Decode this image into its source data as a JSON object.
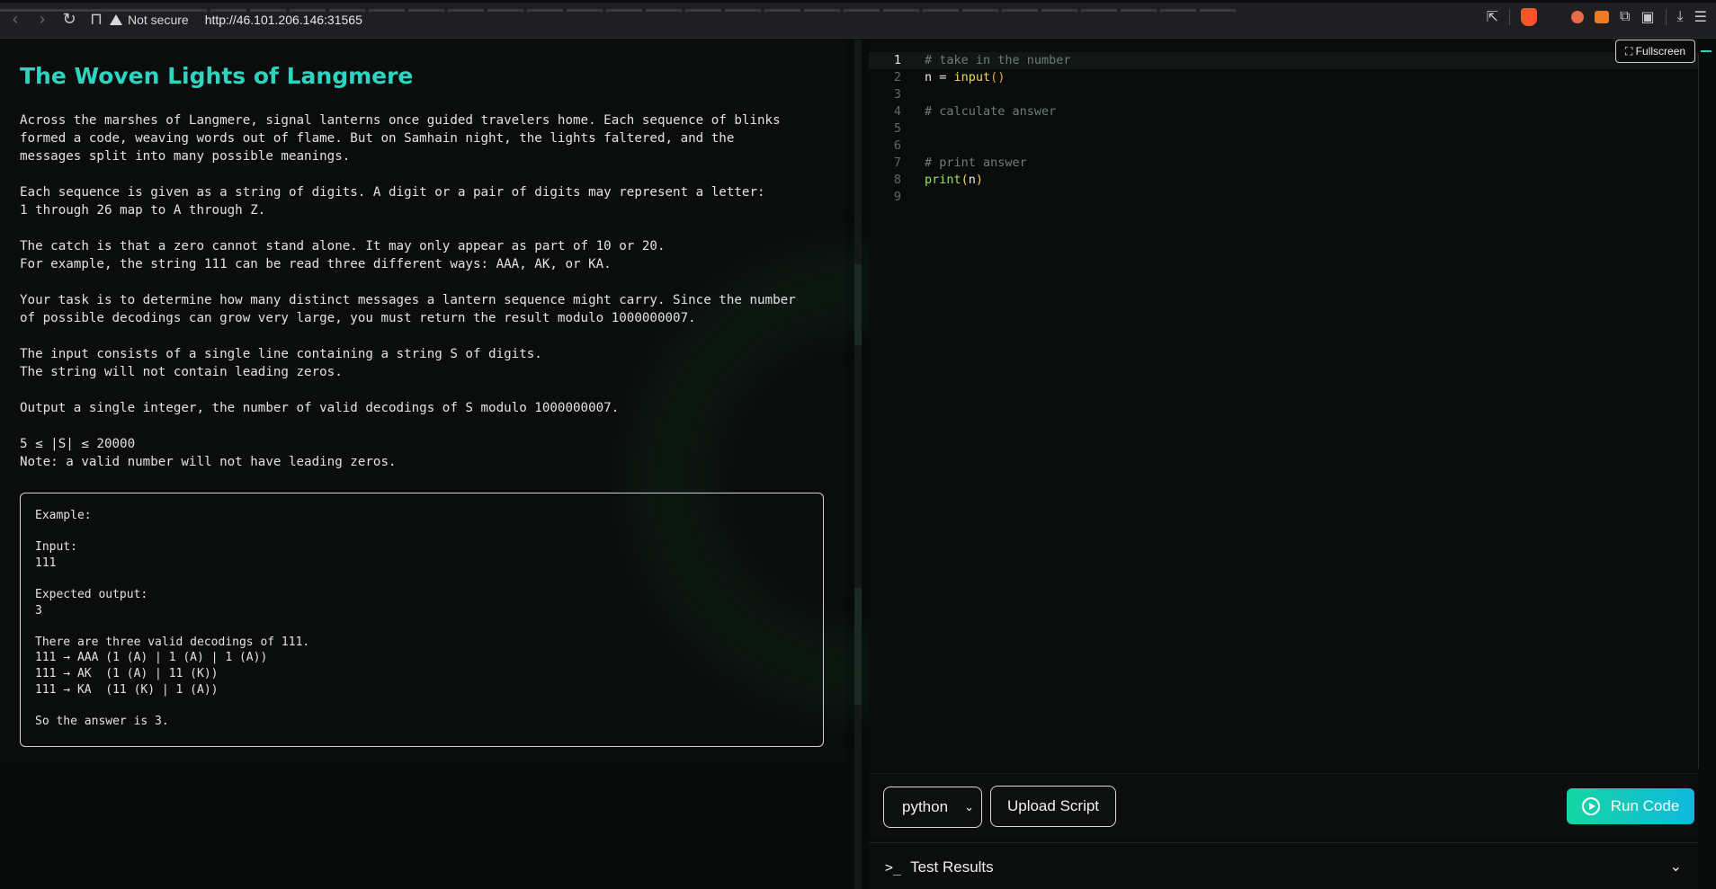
{
  "browser": {
    "security_label": "Not secure",
    "url": "http://46.101.206.146:31565"
  },
  "problem": {
    "title": "The Woven Lights of Langmere",
    "paragraphs": [
      "Across the marshes of Langmere, signal lanterns once guided travelers home. Each sequence of blinks\nformed a code, weaving words out of flame. But on Samhain night, the lights faltered, and the\nmessages split into many possible meanings.",
      "Each sequence is given as a string of digits. A digit or a pair of digits may represent a letter:\n1 through 26 map to A through Z.",
      "The catch is that a zero cannot stand alone. It may only appear as part of 10 or 20.\nFor example, the string 111 can be read three different ways: AAA, AK, or KA.",
      "Your task is to determine how many distinct messages a lantern sequence might carry. Since the number\nof possible decodings can grow very large, you must return the result modulo 1000000007.",
      "The input consists of a single line containing a string S of digits.\nThe string will not contain leading zeros.",
      "Output a single integer, the number of valid decodings of S modulo 1000000007.",
      "5 ≤ |S| ≤ 20000\nNote: a valid number will not have leading zeros."
    ],
    "example": "Example:\n\nInput:\n111\n\nExpected output:\n3\n\nThere are three valid decodings of 111.\n111 → AAA (1 (A) | 1 (A) | 1 (A))\n111 → AK  (1 (A) | 11 (K))\n111 → KA  (11 (K) | 1 (A))\n\nSo the answer is 3."
  },
  "editor": {
    "fullscreen_label": "⛶ Fullscreen",
    "line_numbers": [
      "1",
      "2",
      "3",
      "4",
      "5",
      "6",
      "7",
      "8",
      "9"
    ],
    "lines": {
      "l1": "# take in the number",
      "l2_var": "n = ",
      "l2_fn": "input",
      "l2_paren": "()",
      "l4": "# calculate answer",
      "l7": "# print answer",
      "l8_fn": "print",
      "l8_open": "(",
      "l8_arg": "n",
      "l8_close": ")"
    }
  },
  "toolbar": {
    "language": "python",
    "upload_label": "Upload Script",
    "run_label": "Run Code"
  },
  "results": {
    "prompt": ">_",
    "title": "Test Results"
  }
}
